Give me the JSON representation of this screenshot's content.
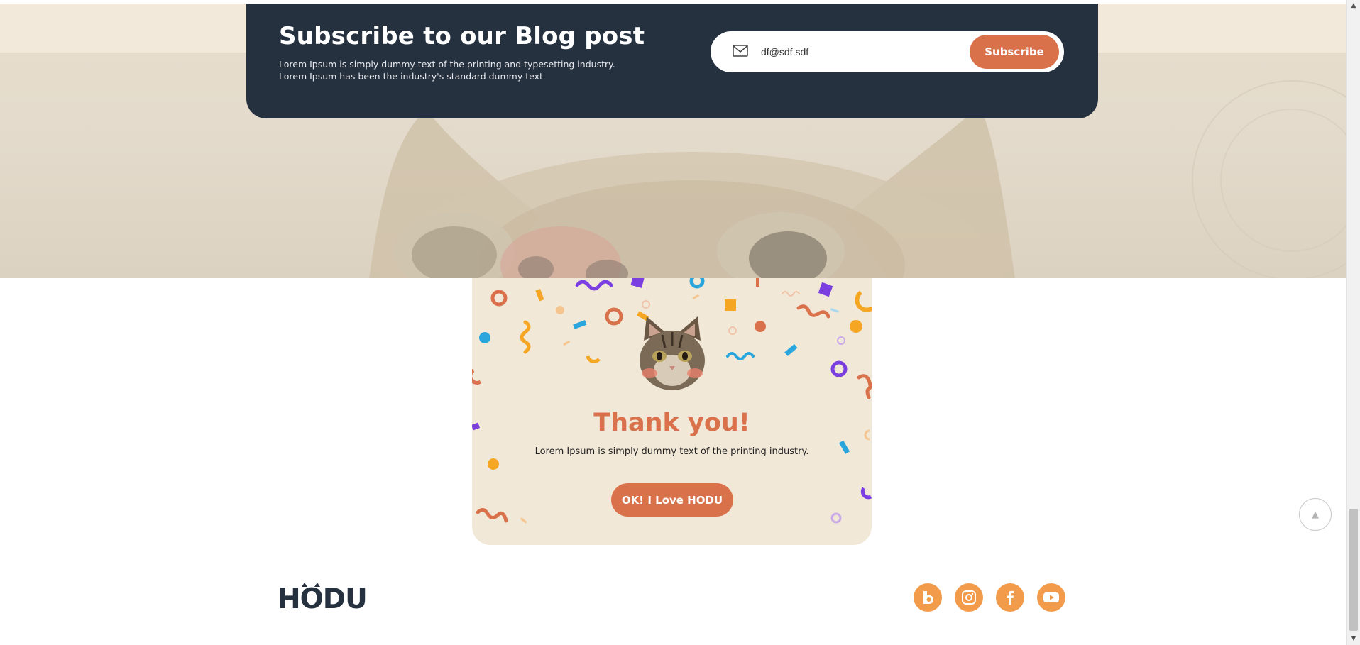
{
  "subscribe": {
    "title": "Subscribe to our Blog post",
    "description_line1": "Lorem Ipsum is simply dummy text of the printing and typesetting industry.",
    "description_line2": "Lorem Ipsum has been the industry's standard dummy text",
    "email_value": "df@sdf.sdf",
    "button_label": "Subscribe",
    "mail_icon": "mail-icon"
  },
  "thank_you": {
    "title": "Thank you!",
    "message": "Lorem Ipsum is simply dummy text of the printing industry.",
    "button_label": "OK! I Love HODU",
    "image": "cat-face"
  },
  "footer": {
    "logo_text": "HODU",
    "socials": [
      {
        "name": "blog",
        "icon": "blog-b-icon"
      },
      {
        "name": "instagram",
        "icon": "instagram-icon"
      },
      {
        "name": "facebook",
        "icon": "facebook-icon"
      },
      {
        "name": "youtube",
        "icon": "youtube-icon"
      }
    ]
  },
  "to_top": {
    "symbol": "▲"
  },
  "scrollbar": {
    "up_symbol": "▲",
    "down_symbol": "▼"
  },
  "colors": {
    "accent": "#d9714b",
    "navy": "#263140",
    "cream": "#f2e8d8",
    "social": "#f29b4b"
  }
}
